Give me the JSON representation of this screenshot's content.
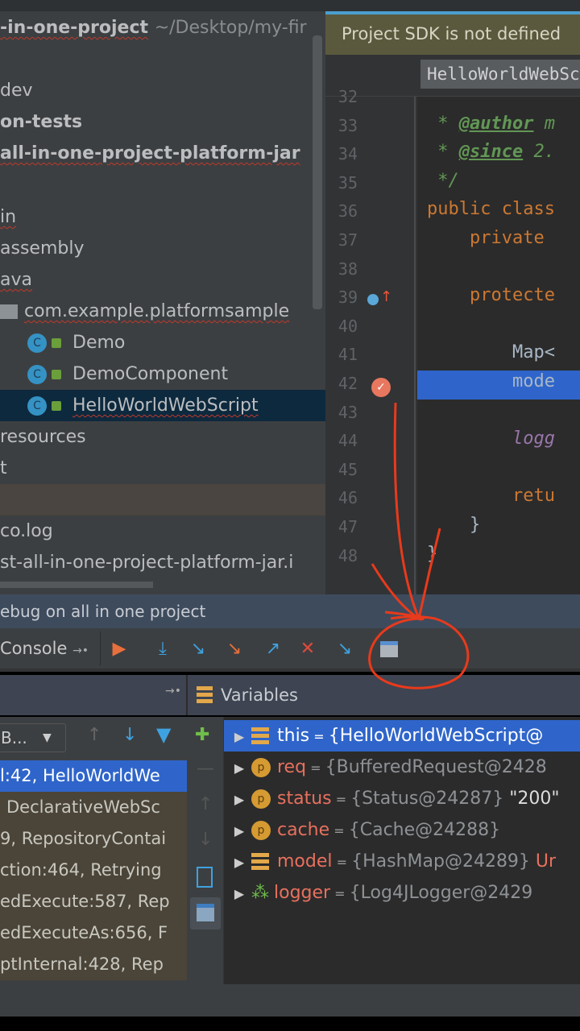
{
  "project": {
    "root_name": "-in-one-project",
    "root_path": "~/Desktop/my-fir",
    "rows": [
      "dev",
      "on-tests",
      "all-in-one-project-platform-jar",
      "",
      "in",
      "assembly",
      "ava",
      "com.example.platformsample",
      "Demo",
      "DemoComponent",
      "HelloWorldWebScript",
      "resources",
      "t",
      "",
      "co.log",
      "st-all-in-one-project-platform-jar.i"
    ]
  },
  "editor": {
    "banner": "Project SDK is not defined",
    "breadcrumb": "HelloWorldWebScript",
    "line_numbers": [
      "32",
      "33",
      "34",
      "35",
      "36",
      "37",
      "38",
      "39",
      "40",
      "41",
      "42",
      "43",
      "44",
      "45",
      "46",
      "47",
      "48"
    ],
    "code": {
      "l33a": " * ",
      "l33b": "@author",
      "l33c": " m",
      "l34a": " * ",
      "l34b": "@since",
      "l34c": " 2.",
      "l35": " */",
      "l36": "public class",
      "l37": "    private",
      "l39": "    protecte",
      "l41": "        Map<",
      "l42": "        mode",
      "l44": "        logg",
      "l46": "        retu",
      "l47": "    }",
      "l48": "}"
    }
  },
  "debug": {
    "title": "ebug on all in one project",
    "console_tab": "Console",
    "frames_dropdown": "B...",
    "frames": [
      "l:42, HelloWorldWe",
      "DeclarativeWebSc",
      "9, RepositoryContai",
      "ction:464, Retrying",
      "edExecute:587, Rep",
      "edExecuteAs:656, F",
      "ptInternal:428, Rep"
    ],
    "variables_title": "Variables",
    "variables": [
      {
        "name": "this",
        "value": "{HelloWorldWebScript@",
        "extra": ""
      },
      {
        "name": "req",
        "value": "{BufferedRequest@2428",
        "extra": ""
      },
      {
        "name": "status",
        "value": "{Status@24287}",
        "extra": " \"200\""
      },
      {
        "name": "cache",
        "value": "{Cache@24288}",
        "extra": ""
      },
      {
        "name": "model",
        "value": "{HashMap@24289}",
        "extra": " Ur"
      },
      {
        "name": "logger",
        "value": "{Log4JLogger@2429",
        "extra": ""
      }
    ]
  },
  "colors": {
    "annotation": "#e83a1c",
    "selection": "#2f65ca"
  }
}
